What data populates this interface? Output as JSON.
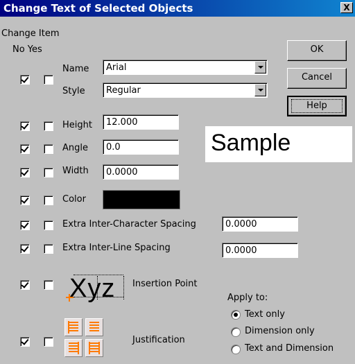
{
  "window": {
    "title": "Change Text of Selected Objects",
    "close_glyph": "X"
  },
  "header": {
    "change_item": "Change Item",
    "no_yes": "No Yes"
  },
  "buttons": {
    "ok": "OK",
    "cancel": "Cancel",
    "help": "Help"
  },
  "rows": {
    "name": {
      "label": "Name",
      "value": "Arial",
      "no_checked": true,
      "yes_checked": false
    },
    "style": {
      "label": "Style",
      "value": "Regular"
    },
    "height": {
      "label": "Height",
      "value": "12.000",
      "no_checked": true,
      "yes_checked": false
    },
    "angle": {
      "label": "Angle",
      "value": "0.0",
      "no_checked": true,
      "yes_checked": false
    },
    "width": {
      "label": "Width",
      "value": "0.0000",
      "no_checked": true,
      "yes_checked": false
    },
    "color": {
      "label": "Color",
      "swatch": "#000000",
      "no_checked": true,
      "yes_checked": false
    },
    "char_spacing": {
      "label": "Extra Inter-Character Spacing",
      "value": "0.0000",
      "no_checked": true,
      "yes_checked": false
    },
    "line_spacing": {
      "label": "Extra Inter-Line Spacing",
      "value": "0.0000",
      "no_checked": true,
      "yes_checked": false
    },
    "insertion": {
      "label": "Insertion Point",
      "sample_glyphs": "Xyz",
      "no_checked": true,
      "yes_checked": false
    },
    "justification": {
      "label": "Justification",
      "no_checked": true,
      "yes_checked": false
    }
  },
  "sample": {
    "text": "Sample"
  },
  "apply_to": {
    "label": "Apply to:",
    "options": [
      "Text only",
      "Dimension only",
      "Text and Dimension"
    ],
    "selected": "Text only"
  },
  "colors": {
    "title_start": "#000080",
    "title_end": "#1084d0",
    "face": "#c0c0c0",
    "accent": "#ff7a00"
  }
}
